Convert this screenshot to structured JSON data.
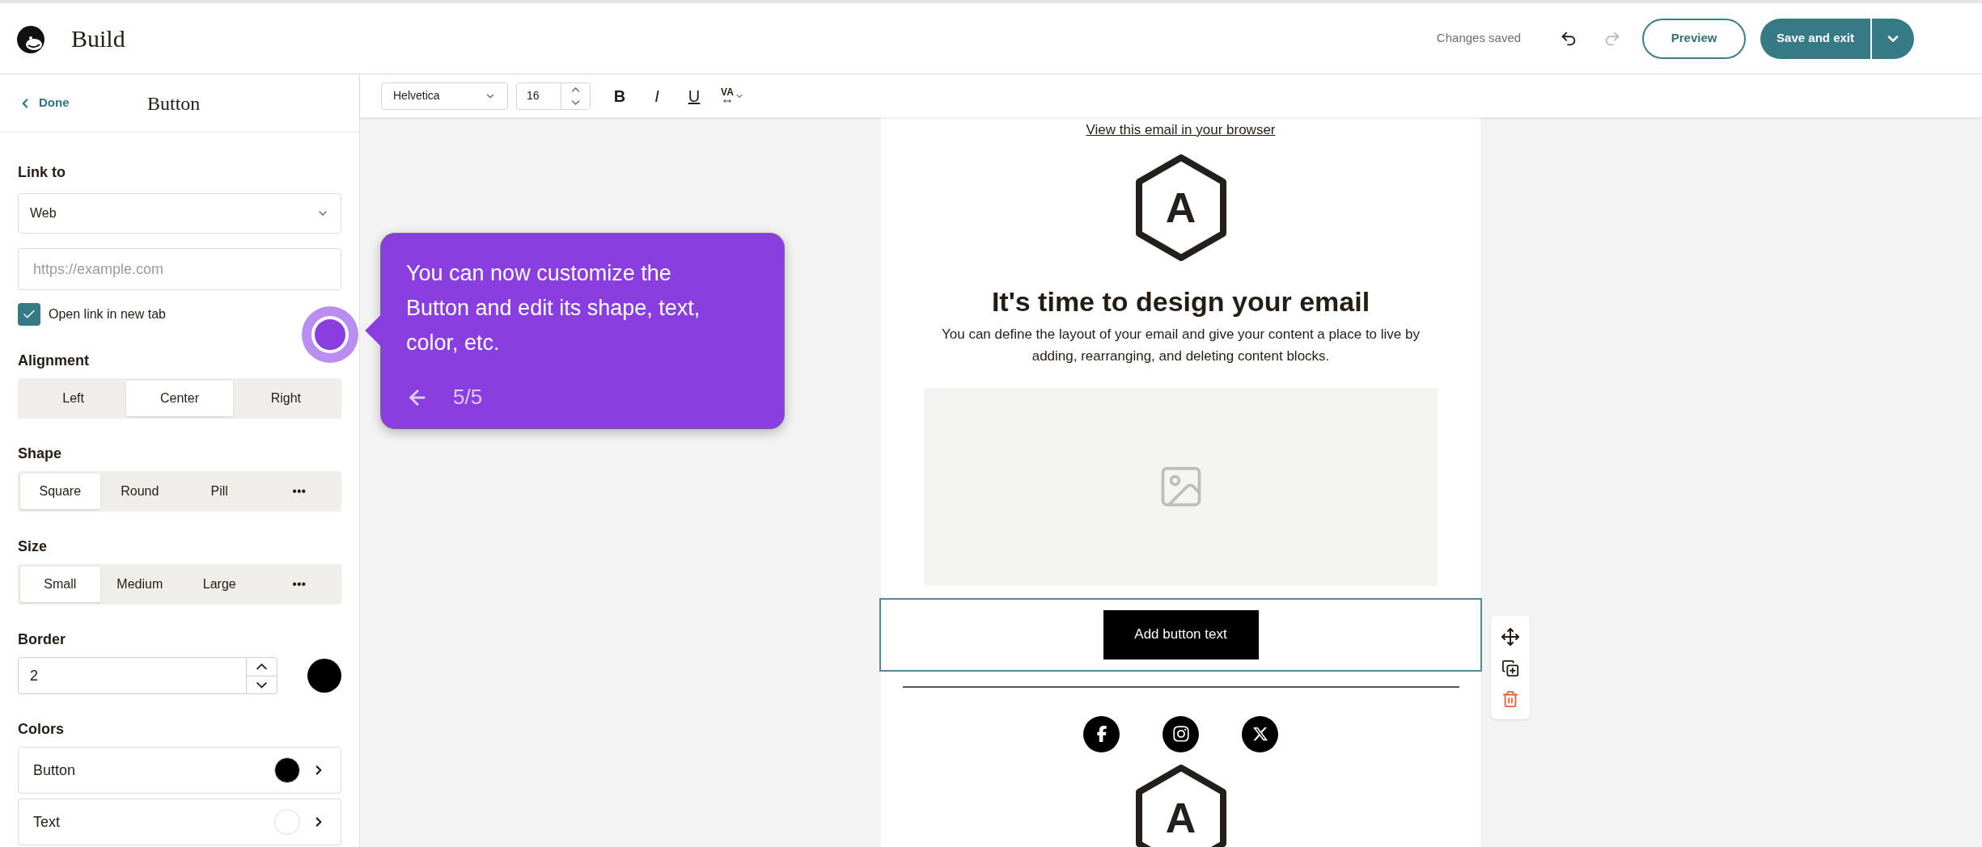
{
  "header": {
    "title": "Build",
    "status": "Changes saved",
    "preview": "Preview",
    "save": "Save and exit"
  },
  "panel": {
    "back": "Done",
    "title": "Button",
    "link_to": {
      "label": "Link to",
      "value": "Web",
      "placeholder": "https://example.com",
      "new_tab": {
        "label": "Open link in new tab",
        "checked": true
      }
    },
    "groups": [
      {
        "label": "Alignment",
        "options": [
          {
            "label": "Left",
            "selected": false
          },
          {
            "label": "Center",
            "selected": true
          },
          {
            "label": "Right",
            "selected": false
          }
        ]
      },
      {
        "label": "Shape",
        "options": [
          {
            "label": "Square",
            "selected": true
          },
          {
            "label": "Round",
            "selected": false
          },
          {
            "label": "Pill",
            "selected": false
          },
          {
            "label": "•••",
            "selected": false
          }
        ]
      },
      {
        "label": "Size",
        "options": [
          {
            "label": "Small",
            "selected": true
          },
          {
            "label": "Medium",
            "selected": false
          },
          {
            "label": "Large",
            "selected": false
          },
          {
            "label": "•••",
            "selected": false
          }
        ]
      }
    ],
    "border": {
      "label": "Border",
      "value": "2",
      "color": "#000000"
    },
    "colors": {
      "label": "Colors",
      "items": [
        {
          "label": "Button",
          "color": "#000000"
        },
        {
          "label": "Text",
          "color": "#ffffff"
        }
      ]
    }
  },
  "toolbar": {
    "font": "Helvetica",
    "size": "16",
    "bold": "B",
    "italic": "I",
    "underline": "U",
    "spacing": "VA"
  },
  "email": {
    "browser_link": "View this email in your browser",
    "logo_letter": "A",
    "heading": "It's time to design your email",
    "body": "You can define the layout of your email and give your content a place to live by adding, rearranging, and deleting content blocks.",
    "button": "Add button text",
    "footer_logo_letter": "A"
  },
  "tooltip": {
    "text": "You can now customize the Button and edit its shape, text, color, etc.",
    "step": "5/5"
  }
}
